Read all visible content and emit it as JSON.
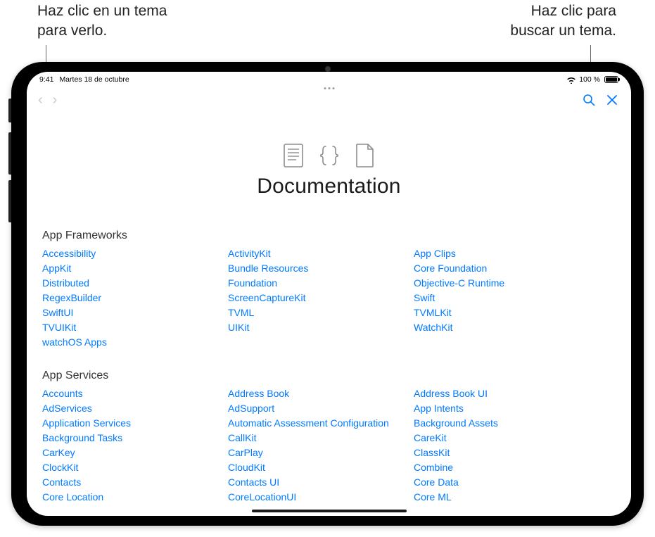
{
  "callouts": {
    "left_line1": "Haz clic en un tema",
    "left_line2": "para verlo.",
    "right_line1": "Haz clic para",
    "right_line2": "buscar un tema."
  },
  "status": {
    "time": "9:41",
    "date": "Martes 18 de octubre",
    "battery_text": "100 %"
  },
  "hero": {
    "title": "Documentation"
  },
  "sections": [
    {
      "title": "App Frameworks",
      "links": [
        "Accessibility",
        "ActivityKit",
        "App Clips",
        "AppKit",
        "Bundle Resources",
        "Core Foundation",
        "Distributed",
        "Foundation",
        "Objective-C Runtime",
        "RegexBuilder",
        "ScreenCaptureKit",
        "Swift",
        "SwiftUI",
        "TVML",
        "TVMLKit",
        "TVUIKit",
        "UIKit",
        "WatchKit",
        "watchOS Apps"
      ]
    },
    {
      "title": "App Services",
      "links": [
        "Accounts",
        "Address Book",
        "Address Book UI",
        "AdServices",
        "AdSupport",
        "App Intents",
        "Application Services",
        "Automatic Assessment Configuration",
        "Background Assets",
        "Background Tasks",
        "CallKit",
        "CareKit",
        "CarKey",
        "CarPlay",
        "ClassKit",
        "ClockKit",
        "CloudKit",
        "Combine",
        "Contacts",
        "Contacts UI",
        "Core Data",
        "Core Location",
        "CoreLocationUI",
        "Core ML"
      ]
    }
  ]
}
